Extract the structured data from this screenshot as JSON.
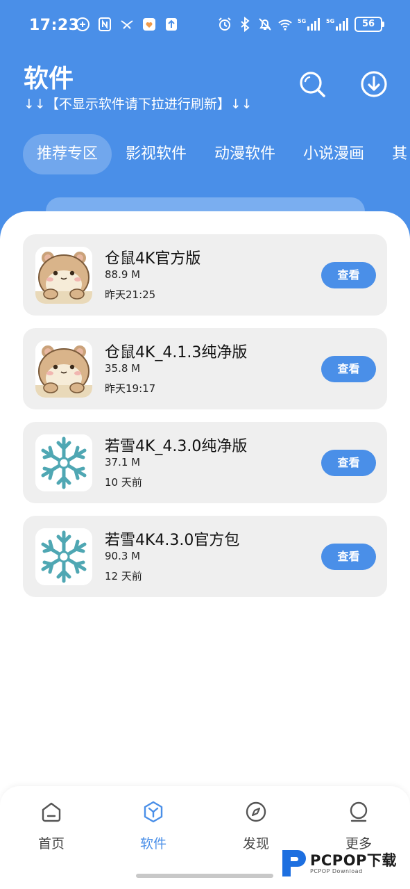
{
  "status_bar": {
    "time": "17:23",
    "battery": "56",
    "network_labels": [
      "5G",
      "5G"
    ]
  },
  "header": {
    "title": "软件",
    "subtitle": "↓↓【不显示软件请下拉进行刷新】↓↓",
    "search_icon": "search-icon",
    "download_icon": "download-icon"
  },
  "tabs": [
    {
      "label": "推荐专区",
      "active": true
    },
    {
      "label": "影视软件",
      "active": false
    },
    {
      "label": "动漫软件",
      "active": false
    },
    {
      "label": "小说漫画",
      "active": false
    },
    {
      "label": "其",
      "active": false
    }
  ],
  "apps": [
    {
      "name": "仓鼠4K官方版",
      "size": "88.9 M",
      "time": "昨天21:25",
      "icon": "hamster-icon",
      "button": "查看"
    },
    {
      "name": "仓鼠4K_4.1.3纯净版",
      "size": "35.8 M",
      "time": "昨天19:17",
      "icon": "hamster-icon",
      "button": "查看"
    },
    {
      "name": "若雪4K_4.3.0纯净版",
      "size": "37.1 M",
      "time": "10 天前",
      "icon": "snowflake-icon",
      "button": "查看"
    },
    {
      "name": "若雪4K4.3.0官方包",
      "size": "90.3 M",
      "time": "12 天前",
      "icon": "snowflake-icon",
      "button": "查看"
    }
  ],
  "bottom_nav": [
    {
      "label": "首页",
      "icon": "home-icon",
      "active": false
    },
    {
      "label": "软件",
      "icon": "box-icon",
      "active": true
    },
    {
      "label": "发现",
      "icon": "compass-icon",
      "active": false
    },
    {
      "label": "更多",
      "icon": "user-icon",
      "active": false
    }
  ],
  "watermark": {
    "main": "PCPOP下载",
    "sub": "PCPOP Download"
  },
  "colors": {
    "accent": "#4a8fe8",
    "card_bg": "#efefef",
    "snowflake": "#4fa7b3"
  }
}
